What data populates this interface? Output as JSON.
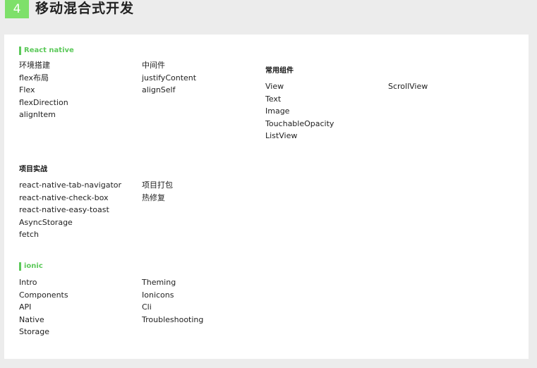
{
  "header": {
    "number": "4",
    "title": "移动混合式开发"
  },
  "react_native": {
    "label": "React native",
    "col1": [
      "环境搭建",
      "flex布局",
      "Flex",
      "flexDirection",
      "alignItem"
    ],
    "col2": [
      "中间件",
      "justifyContent",
      "alignSelf"
    ]
  },
  "common_components": {
    "heading": "常用组件",
    "col1": [
      "View",
      "Text",
      "Image",
      "TouchableOpacity",
      "ListView"
    ],
    "col2": [
      "ScrollView"
    ]
  },
  "project": {
    "heading": "项目实战",
    "col1": [
      "react-native-tab-navigator",
      "react-native-check-box",
      "react-native-easy-toast",
      "AsyncStorage",
      "fetch"
    ],
    "col2": [
      "项目打包",
      "热修复"
    ]
  },
  "ionic": {
    "label": "ionic",
    "col1": [
      "Intro",
      "Components",
      "API",
      "Native",
      "Storage"
    ],
    "col2": [
      "Theming",
      "Ionicons",
      "Cli",
      "Troubleshooting"
    ]
  },
  "colors": {
    "accent": "#7ee06a",
    "label_green": "#5cc95a",
    "background": "#ececec",
    "panel": "#ffffff"
  }
}
